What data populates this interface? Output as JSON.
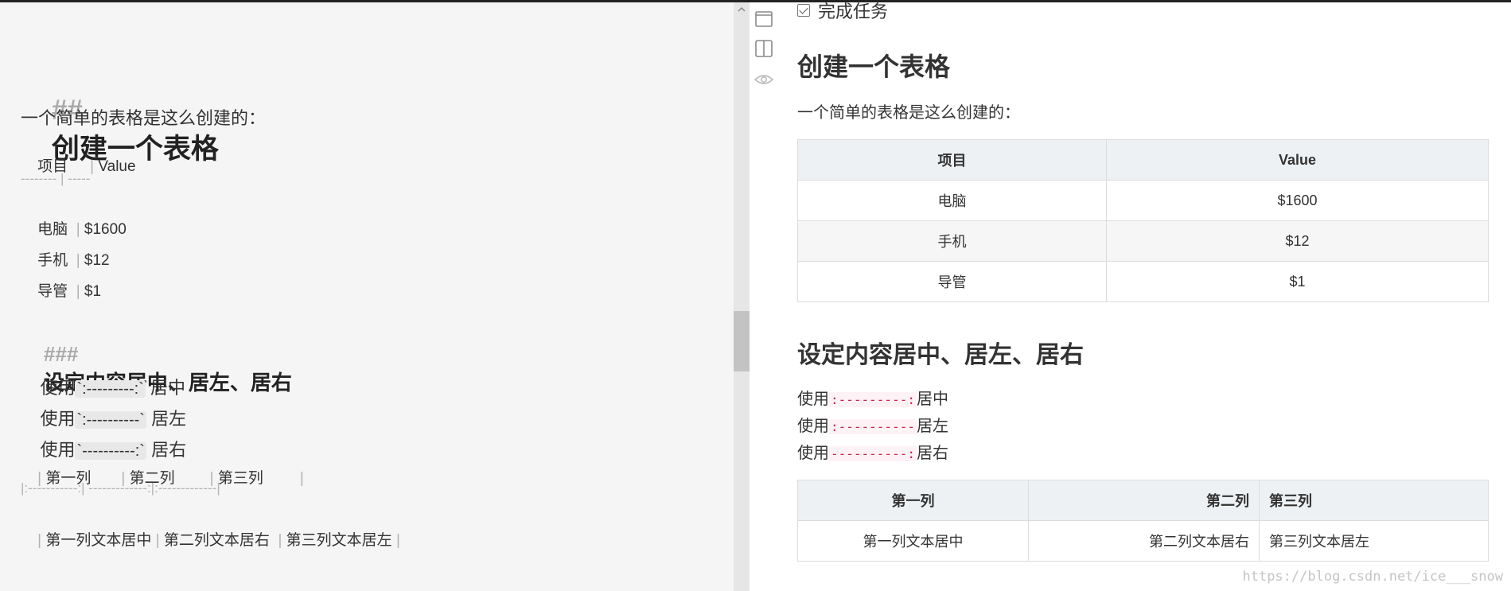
{
  "editor": {
    "h2_mark": "##",
    "h2_text": "创建一个表格",
    "intro": "一个简单的表格是这么创建的：",
    "table_lines": [
      {
        "a": "项目",
        "b": "Value"
      },
      {
        "a": "电脑",
        "b": "$1600"
      },
      {
        "a": "手机",
        "b": "$12"
      },
      {
        "a": "导管",
        "b": "$1"
      }
    ],
    "table_sep": "-------- | -----",
    "h3_mark": "###",
    "h3_text": "设定内容居中、居左、居右",
    "usage": [
      {
        "prefix": "使用",
        "code": "`:---------:`",
        "suffix": "居中"
      },
      {
        "prefix": "使用",
        "code": "`:----------`",
        "suffix": "居左"
      },
      {
        "prefix": "使用",
        "code": "`----------:`",
        "suffix": "居右"
      }
    ],
    "align_header": [
      "第一列",
      "第二列",
      "第三列"
    ],
    "align_sep": "|:-----------:| -------------:|:-------------|",
    "align_row": [
      "第一列文本居中",
      "第二列文本居右",
      "第三列文本居左"
    ],
    "pipe": "|"
  },
  "preview": {
    "task_label": "完成任务",
    "h2": "创建一个表格",
    "intro": "一个简单的表格是这么创建的：",
    "table1": {
      "headers": [
        "项目",
        "Value"
      ],
      "rows": [
        [
          "电脑",
          "$1600"
        ],
        [
          "手机",
          "$12"
        ],
        [
          "导管",
          "$1"
        ]
      ]
    },
    "h3": "设定内容居中、居左、居右",
    "usage": [
      {
        "prefix": "使用",
        "code": ":---------:",
        "suffix": "居中"
      },
      {
        "prefix": "使用",
        "code": ":----------",
        "suffix": "居左"
      },
      {
        "prefix": "使用",
        "code": "----------:",
        "suffix": "居右"
      }
    ],
    "table2": {
      "headers": [
        "第一列",
        "第二列",
        "第三列"
      ],
      "rows": [
        [
          "第一列文本居中",
          "第二列文本居右",
          "第三列文本居左"
        ]
      ]
    }
  },
  "toolbar": {
    "icons": [
      "single-column-icon",
      "split-view-icon",
      "preview-eye-icon"
    ]
  },
  "watermark": "https://blog.csdn.net/ice___snow",
  "colors": {
    "code_text": "#c7254e",
    "code_bg": "#fdf2f5",
    "table_header_bg": "#eef1f4"
  }
}
